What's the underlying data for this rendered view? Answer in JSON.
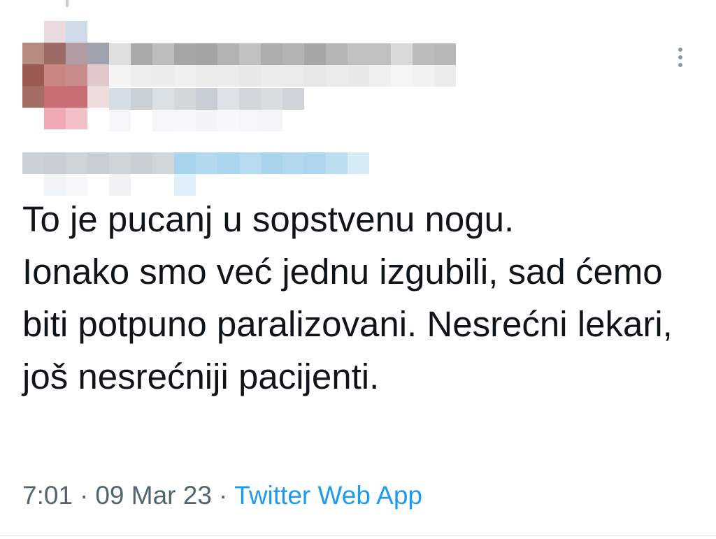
{
  "tweet": {
    "text": "To je pucanj u sopstvenu nogu.\nIonako smo već jednu izgubili, sad ćemo biti potpuno paralizovani. Nesrećni lekari, još nesrećniji pacijenti.",
    "time": "7:01",
    "separator": "·",
    "date": "09 Mar 23",
    "source": "Twitter Web App"
  },
  "icons": {
    "more": "more-vertical-icon"
  },
  "colors": {
    "text": "#0f1419",
    "meta": "#536471",
    "link": "#1d9bf0",
    "icon": "#8b98a5"
  },
  "pixelation": {
    "avatar": [
      [
        "#ffffff",
        "#ead9dd",
        "#cfdbe8",
        "#ffffff"
      ],
      [
        "#b58a7f",
        "#9c6b66",
        "#b29aa3",
        "#9ea3ad"
      ],
      [
        "#9b5b52",
        "#c98581",
        "#c98c8c",
        "#e1c8cb"
      ],
      [
        "#a56d63",
        "#c86d73",
        "#c86d73",
        "#efdcdc"
      ],
      [
        "#ffffff",
        "#f0a8b5",
        "#f4c0c8",
        "#ffffff"
      ]
    ],
    "name": [
      [
        "#dedede",
        "#aaaaaa",
        "#bdbdbd",
        "#a6a6a6",
        "#a4a4a4",
        "#b3b3b3",
        "#c1c1c1",
        "#adadad",
        "#b3b3b3",
        "#a6a6a6",
        "#b5b5b5",
        "#c0c0c0",
        "#c0c0c0",
        "#dadada",
        "#bcbcbc",
        "#b7b7b7"
      ],
      [
        "#f4f4f4",
        "#ededed",
        "#ececec",
        "#efefef",
        "#eaeaea",
        "#ececec",
        "#e8e8e8",
        "#ebebeb",
        "#eaeaea",
        "#e7e7e7",
        "#ebebeb",
        "#e8e8e8",
        "#efefef",
        "#f5f5f5",
        "#f2f2f2",
        "#ececec"
      ]
    ],
    "handle": [
      [
        "#d5dde6",
        "#c9d0d6",
        "#d8e0e6",
        "#d2d7dc",
        "#c6cdd4",
        "#dce2e8",
        "#d0d6dc",
        "#d8dde2",
        "#cfd5db"
      ],
      [
        "#f5f6f8",
        "#ffffff",
        "#f4f6f8",
        "#f6f7f8",
        "#f2f4f6",
        "#f6f8f9",
        "#f4f6f8",
        "#f3f5f7",
        "#ffffff"
      ]
    ],
    "reply": [
      [
        "#ccd1d7",
        "#c8ced4",
        "#ced3d8",
        "#c8cdd3",
        "#cfd4d9",
        "#c9cfd5",
        "#d1d6db",
        "#a9d4ee",
        "#b3d9f0",
        "#aad5ee",
        "#b6dbf1",
        "#a8d4ee",
        "#b1d8ef",
        "#acd6ef",
        "#bcdef1",
        "#d6ebf6"
      ],
      [
        "#ffffff",
        "#f1f4f6",
        "#f6f7f8",
        "#ffffff",
        "#f0f2f4",
        "#ffffff",
        "#ffffff",
        "#dff0fa",
        "#ffffff",
        "#ffffff",
        "#ffffff",
        "#ffffff",
        "#ffffff",
        "#ffffff",
        "#ffffff",
        "#ffffff"
      ]
    ]
  }
}
